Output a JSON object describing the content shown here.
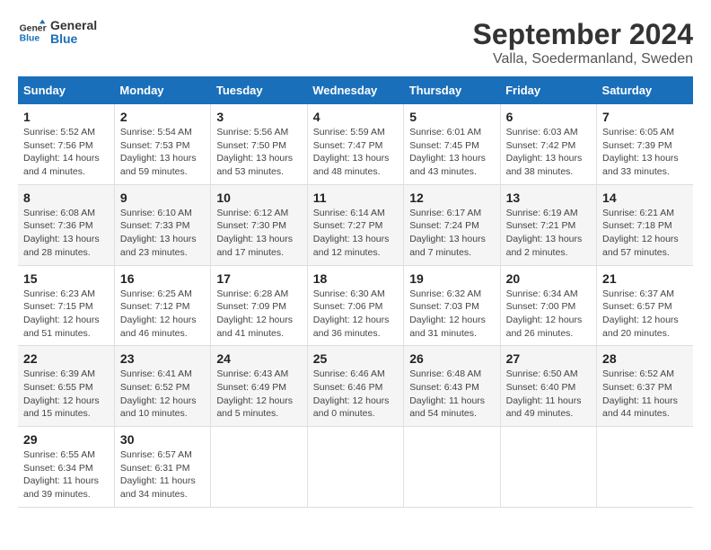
{
  "logo": {
    "line1": "General",
    "line2": "Blue"
  },
  "title": "September 2024",
  "subtitle": "Valla, Soedermanland, Sweden",
  "weekdays": [
    "Sunday",
    "Monday",
    "Tuesday",
    "Wednesday",
    "Thursday",
    "Friday",
    "Saturday"
  ],
  "weeks": [
    [
      {
        "day": "1",
        "detail": "Sunrise: 5:52 AM\nSunset: 7:56 PM\nDaylight: 14 hours\nand 4 minutes."
      },
      {
        "day": "2",
        "detail": "Sunrise: 5:54 AM\nSunset: 7:53 PM\nDaylight: 13 hours\nand 59 minutes."
      },
      {
        "day": "3",
        "detail": "Sunrise: 5:56 AM\nSunset: 7:50 PM\nDaylight: 13 hours\nand 53 minutes."
      },
      {
        "day": "4",
        "detail": "Sunrise: 5:59 AM\nSunset: 7:47 PM\nDaylight: 13 hours\nand 48 minutes."
      },
      {
        "day": "5",
        "detail": "Sunrise: 6:01 AM\nSunset: 7:45 PM\nDaylight: 13 hours\nand 43 minutes."
      },
      {
        "day": "6",
        "detail": "Sunrise: 6:03 AM\nSunset: 7:42 PM\nDaylight: 13 hours\nand 38 minutes."
      },
      {
        "day": "7",
        "detail": "Sunrise: 6:05 AM\nSunset: 7:39 PM\nDaylight: 13 hours\nand 33 minutes."
      }
    ],
    [
      {
        "day": "8",
        "detail": "Sunrise: 6:08 AM\nSunset: 7:36 PM\nDaylight: 13 hours\nand 28 minutes."
      },
      {
        "day": "9",
        "detail": "Sunrise: 6:10 AM\nSunset: 7:33 PM\nDaylight: 13 hours\nand 23 minutes."
      },
      {
        "day": "10",
        "detail": "Sunrise: 6:12 AM\nSunset: 7:30 PM\nDaylight: 13 hours\nand 17 minutes."
      },
      {
        "day": "11",
        "detail": "Sunrise: 6:14 AM\nSunset: 7:27 PM\nDaylight: 13 hours\nand 12 minutes."
      },
      {
        "day": "12",
        "detail": "Sunrise: 6:17 AM\nSunset: 7:24 PM\nDaylight: 13 hours\nand 7 minutes."
      },
      {
        "day": "13",
        "detail": "Sunrise: 6:19 AM\nSunset: 7:21 PM\nDaylight: 13 hours\nand 2 minutes."
      },
      {
        "day": "14",
        "detail": "Sunrise: 6:21 AM\nSunset: 7:18 PM\nDaylight: 12 hours\nand 57 minutes."
      }
    ],
    [
      {
        "day": "15",
        "detail": "Sunrise: 6:23 AM\nSunset: 7:15 PM\nDaylight: 12 hours\nand 51 minutes."
      },
      {
        "day": "16",
        "detail": "Sunrise: 6:25 AM\nSunset: 7:12 PM\nDaylight: 12 hours\nand 46 minutes."
      },
      {
        "day": "17",
        "detail": "Sunrise: 6:28 AM\nSunset: 7:09 PM\nDaylight: 12 hours\nand 41 minutes."
      },
      {
        "day": "18",
        "detail": "Sunrise: 6:30 AM\nSunset: 7:06 PM\nDaylight: 12 hours\nand 36 minutes."
      },
      {
        "day": "19",
        "detail": "Sunrise: 6:32 AM\nSunset: 7:03 PM\nDaylight: 12 hours\nand 31 minutes."
      },
      {
        "day": "20",
        "detail": "Sunrise: 6:34 AM\nSunset: 7:00 PM\nDaylight: 12 hours\nand 26 minutes."
      },
      {
        "day": "21",
        "detail": "Sunrise: 6:37 AM\nSunset: 6:57 PM\nDaylight: 12 hours\nand 20 minutes."
      }
    ],
    [
      {
        "day": "22",
        "detail": "Sunrise: 6:39 AM\nSunset: 6:55 PM\nDaylight: 12 hours\nand 15 minutes."
      },
      {
        "day": "23",
        "detail": "Sunrise: 6:41 AM\nSunset: 6:52 PM\nDaylight: 12 hours\nand 10 minutes."
      },
      {
        "day": "24",
        "detail": "Sunrise: 6:43 AM\nSunset: 6:49 PM\nDaylight: 12 hours\nand 5 minutes."
      },
      {
        "day": "25",
        "detail": "Sunrise: 6:46 AM\nSunset: 6:46 PM\nDaylight: 12 hours\nand 0 minutes."
      },
      {
        "day": "26",
        "detail": "Sunrise: 6:48 AM\nSunset: 6:43 PM\nDaylight: 11 hours\nand 54 minutes."
      },
      {
        "day": "27",
        "detail": "Sunrise: 6:50 AM\nSunset: 6:40 PM\nDaylight: 11 hours\nand 49 minutes."
      },
      {
        "day": "28",
        "detail": "Sunrise: 6:52 AM\nSunset: 6:37 PM\nDaylight: 11 hours\nand 44 minutes."
      }
    ],
    [
      {
        "day": "29",
        "detail": "Sunrise: 6:55 AM\nSunset: 6:34 PM\nDaylight: 11 hours\nand 39 minutes."
      },
      {
        "day": "30",
        "detail": "Sunrise: 6:57 AM\nSunset: 6:31 PM\nDaylight: 11 hours\nand 34 minutes."
      },
      null,
      null,
      null,
      null,
      null
    ]
  ]
}
